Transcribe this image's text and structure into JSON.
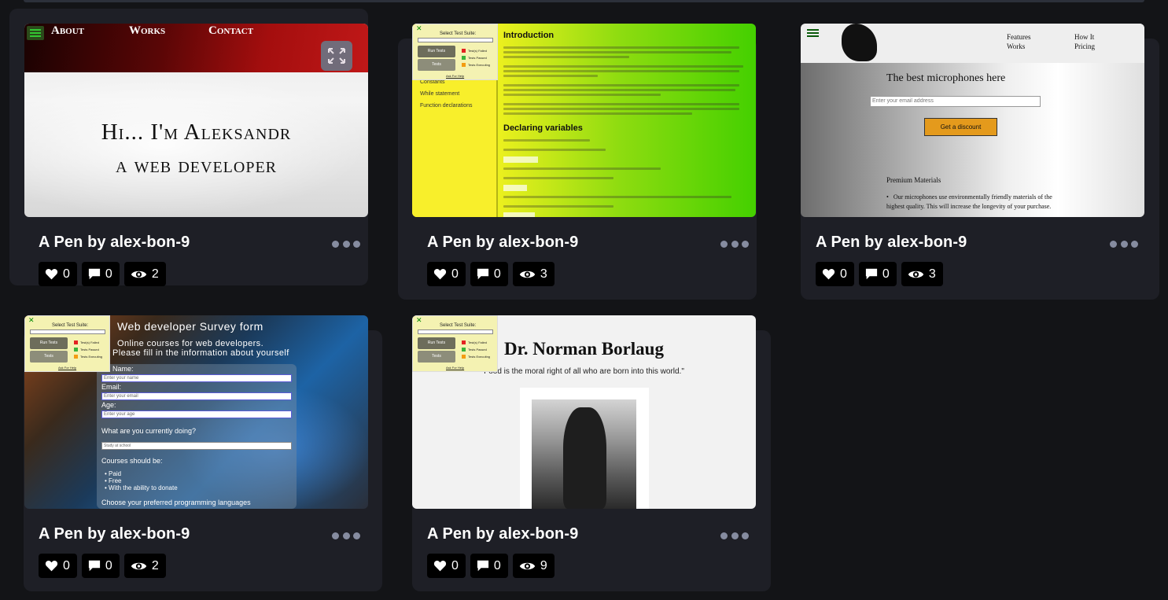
{
  "cards": [
    {
      "title": "A Pen by alex-bon-9",
      "likes": "0",
      "comments": "0",
      "views": "2",
      "preview": {
        "nav": [
          "About",
          "Works",
          "Contact"
        ],
        "hero_line1": "Hi... I'm Aleksandr",
        "hero_line2": "a web developer"
      }
    },
    {
      "title": "A Pen by alex-bon-9",
      "likes": "0",
      "comments": "0",
      "views": "3",
      "preview": {
        "suite_label": "Select Test Suite:",
        "run_tests": "Run Tests",
        "tests": "Tests",
        "status": [
          "Test(s) Failed",
          "Tests Passed",
          "Tests Executing"
        ],
        "help": "Ask For Help",
        "nav_items": [
          "Constants",
          "While statement",
          "Function declarations"
        ],
        "heading1": "Introduction",
        "heading2": "Declaring variables"
      }
    },
    {
      "title": "A Pen by alex-bon-9",
      "likes": "0",
      "comments": "0",
      "views": "3",
      "preview": {
        "nav": [
          "Features",
          "How It",
          "Works",
          "Pricing"
        ],
        "headline": "The best microphones here",
        "email_placeholder": "Enter your email address",
        "button": "Get a discount",
        "section": "Premium Materials",
        "bullet": "Our microphones use environmentally friendly materials of the highest quality. This will increase the longevity of your purchase."
      }
    },
    {
      "title": "A Pen by alex-bon-9",
      "likes": "0",
      "comments": "0",
      "views": "2",
      "preview": {
        "title": "Web developer Survey form",
        "sub1": "Online courses for web developers.",
        "sub2": "Please fill in the information about yourself",
        "labels": [
          "Name:",
          "Email:",
          "Age:",
          "What are you currently doing?",
          "Courses should be:",
          "Choose your preferred programming languages"
        ],
        "placeholders": [
          "Enter your name",
          "Enter your email",
          "Enter your age"
        ],
        "select": "Study at school",
        "options": [
          "Paid",
          "Free",
          "With the ability to donate"
        ]
      }
    },
    {
      "title": "A Pen by alex-bon-9",
      "likes": "0",
      "comments": "0",
      "views": "9",
      "preview": {
        "name": "Dr. Norman Borlaug",
        "quote": "Food is the moral right of all who are born into this world.\""
      }
    }
  ]
}
